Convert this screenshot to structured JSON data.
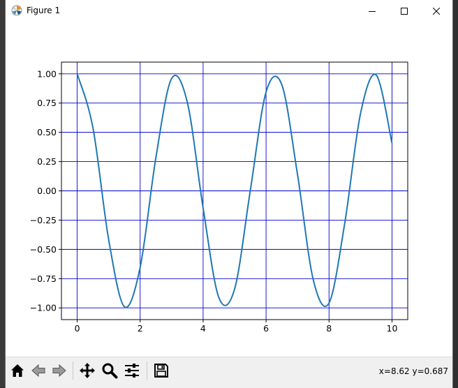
{
  "window": {
    "title": "Figure 1",
    "controls": {
      "minimize_icon": "minimize-icon",
      "maximize_icon": "maximize-icon",
      "close_icon": "close-icon"
    }
  },
  "toolbar": {
    "buttons": [
      {
        "name": "home",
        "icon": "home-icon"
      },
      {
        "name": "back",
        "icon": "back-arrow-icon"
      },
      {
        "name": "forward",
        "icon": "forward-arrow-icon"
      },
      {
        "name": "pan",
        "icon": "move-arrows-icon"
      },
      {
        "name": "zoom",
        "icon": "magnifier-icon"
      },
      {
        "name": "configure-subplots",
        "icon": "sliders-icon"
      },
      {
        "name": "save",
        "icon": "floppy-disk-icon"
      }
    ],
    "coords": "x=8.62 y=0.687"
  },
  "chart_data": {
    "type": "line",
    "title": "",
    "xlabel": "",
    "ylabel": "",
    "xlim": [
      -0.5,
      10.5
    ],
    "ylim": [
      -1.1,
      1.1
    ],
    "xticks": [
      0,
      2,
      4,
      6,
      8,
      10
    ],
    "xtick_labels": [
      "0",
      "2",
      "4",
      "6",
      "8",
      "10"
    ],
    "yticks": [
      1.0,
      0.75,
      0.5,
      0.25,
      0.0,
      -0.25,
      -0.5,
      -0.75,
      -1.0
    ],
    "ytick_labels": [
      "1.00",
      "0.75",
      "0.50",
      "0.25",
      "0.00",
      "−0.25",
      "−0.50",
      "−0.75",
      "−1.00"
    ],
    "grid": true,
    "grid_color": "#0000cc",
    "series": [
      {
        "color": "#1f77b4",
        "x": [
          0,
          0.5,
          1,
          1.5,
          2,
          2.5,
          3,
          3.5,
          4,
          4.5,
          5,
          5.5,
          6,
          6.5,
          7,
          7.5,
          8,
          8.5,
          9,
          9.5,
          10
        ],
        "y": [
          1.0,
          0.54,
          -0.416,
          -0.99,
          -0.654,
          0.284,
          0.96,
          0.754,
          -0.146,
          -0.911,
          -0.839,
          0.004,
          0.844,
          0.907,
          0.137,
          -0.76,
          -0.958,
          -0.275,
          0.66,
          0.989,
          0.408
        ]
      }
    ]
  }
}
